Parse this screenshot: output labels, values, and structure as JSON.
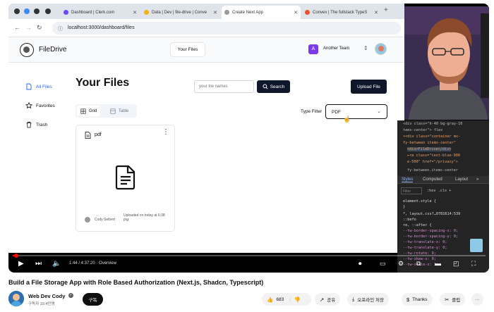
{
  "browser": {
    "tabs": [
      {
        "label": "Dashboard | Clerk.com",
        "active": false
      },
      {
        "label": "Data | Dev | file-drive | Conve",
        "active": false
      },
      {
        "label": "Create Next App",
        "active": true
      },
      {
        "label": "Convex | The fullstack TypeS",
        "active": false
      }
    ],
    "url": "localhost:3000/dashboard/files"
  },
  "app": {
    "name": "FileDrive",
    "header_button": "Your Files",
    "team_initial": "A",
    "team_name": "Another Team"
  },
  "sidebar": {
    "items": [
      {
        "label": "All Files",
        "active": true
      },
      {
        "label": "Favorites",
        "active": false
      },
      {
        "label": "Trash",
        "active": false
      }
    ]
  },
  "main": {
    "title": "Your Files",
    "search_placeholder": "your file names",
    "search_button": "Search",
    "upload_button": "Upload File",
    "view_tabs": [
      "Grid",
      "Table"
    ],
    "type_filter_label": "Type Filter",
    "type_filter_value": "PDF"
  },
  "file_card": {
    "title": "pdf",
    "owner": "Cody Seibert",
    "uploaded": "Uploaded on today at 6:38 PM"
  },
  "devtools": {
    "lines": [
      "<div class=\"h-40 bg-gray-10",
      "tems-center\"> flex",
      "▾<div class=\"container mx-",
      "fy-between items-center\"",
      "<div>FileDrive</div>",
      "▸<a class=\"text-blue-900",
      "e-500\" href=\"/privacy\">",
      "fy-between.items-center"
    ],
    "tabs": [
      "Styles",
      "Computed",
      "Layout"
    ],
    "filter_placeholder": "Filter",
    "filter_tools": ":hov  .cls  +",
    "style_lines": [
      "element.style {",
      "}",
      "*,              layout.css?…0781614:539",
      "::befo",
      "re, ::after {",
      "  --tw-border-spacing-x: 0;",
      "  --tw-border-spacing-y: 0;",
      "  --tw-translate-x: 0;",
      "  --tw-translate-y: 0;",
      "  --tw-rotate: 0;",
      "  --tw-skew-x: 0;",
      "  --tw-scale-x: 1;"
    ]
  },
  "video": {
    "time": "1:44 / 4:37:20 · Overview",
    "title": "Build a File Storage App with Role Based Authorization (Next.js, Shadcn, Typescript)",
    "progress_fraction": 0.0064
  },
  "channel": {
    "name": "Web Dev Cody",
    "subscribers": "구독자 19.4만명",
    "subscribe_label": "구독"
  },
  "actions": {
    "likes": "683",
    "share": "공유",
    "offline": "오프라인 저장",
    "thanks": "Thanks",
    "clip": "클립",
    "more": "···"
  },
  "colors": {
    "accent": "#2563eb",
    "primary_button": "#0f172a",
    "progress": "#ff0000",
    "team_avatar": "#7c3aed"
  }
}
